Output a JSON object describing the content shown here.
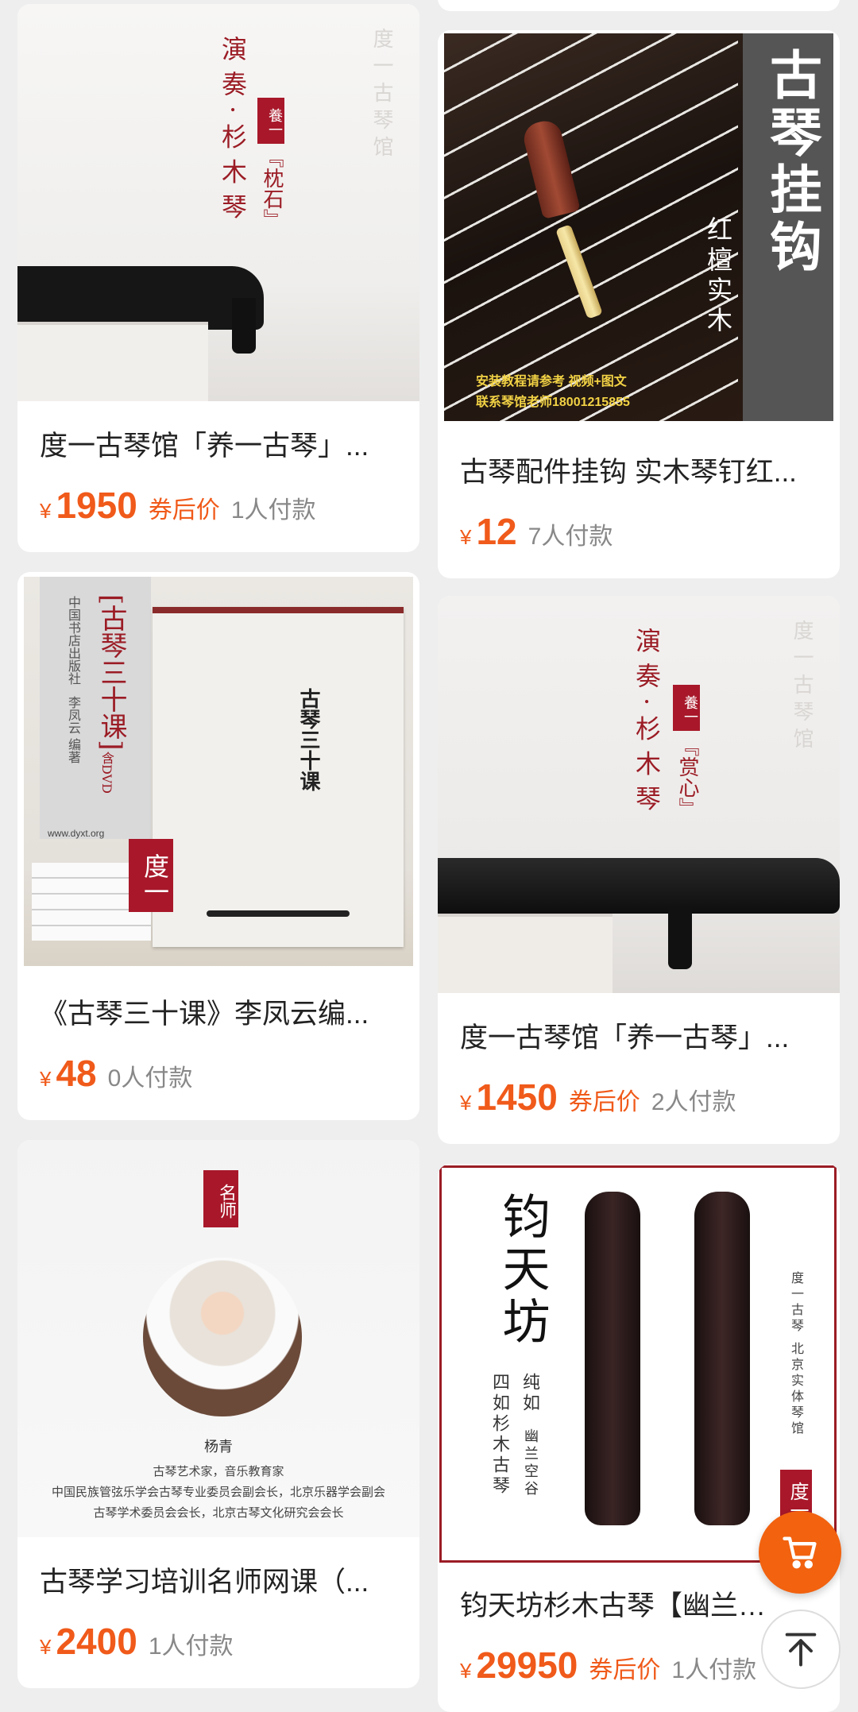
{
  "products": [
    {
      "title": "度一古琴馆「养一古琴」...",
      "price": "1950",
      "coupon": "券后价",
      "sold": "1人付款",
      "art": {
        "vertical_main": "演奏·杉木琴",
        "seal": "養一",
        "sub": "『枕石』",
        "watermark": "度一古琴馆"
      }
    },
    {
      "title": "古琴配件挂钩 实木琴钉红...",
      "price": "12",
      "coupon": "",
      "sold": "7人付款",
      "art": {
        "big": "古琴挂钩",
        "side": "红檀实木",
        "note1": "安装教程请参考 视频+图文",
        "note2": "联系琴馆老师18001215855"
      }
    },
    {
      "title": "《古琴三十课》李凤云编...",
      "price": "48",
      "coupon": "",
      "sold": "0人付款",
      "art": {
        "spine": "[古琴三十课]",
        "spine_dvd": "含DVD",
        "publisher": "中国书店出版社",
        "author": "李凤云 编著",
        "url": "www.dyxt.org",
        "cover_title": "古琴三十课",
        "seal": "度一"
      }
    },
    {
      "title": "度一古琴馆「养一古琴」...",
      "price": "1450",
      "coupon": "券后价",
      "sold": "2人付款",
      "art": {
        "vertical_main": "演奏·杉木琴",
        "seal": "養一",
        "sub": "『赏心』",
        "watermark": "度一古琴馆"
      }
    },
    {
      "title": "古琴学习培训名师网课（...",
      "price": "2400",
      "coupon": "",
      "sold": "1人付款",
      "art": {
        "seal": "名师",
        "name": "杨青",
        "line1": "古琴艺术家，音乐教育家",
        "line2": "中国民族管弦乐学会古琴专业委员会副会长，北京乐器学会副会",
        "line3": "古琴学术委员会会长，北京古琴文化研究会会长"
      }
    },
    {
      "title": "钧天坊杉木古琴【幽兰空...",
      "price": "29950",
      "coupon": "券后价",
      "sold": "1人付款",
      "art": {
        "big": "钧天坊",
        "col1": "四如杉木古琴",
        "col2": "纯如",
        "col3": "幽兰空谷",
        "side": "度一古琴 北京实体琴馆",
        "seal": "度一"
      }
    }
  ],
  "currency_symbol": "¥",
  "floating": {
    "cart_icon": "cart-icon",
    "top_icon": "back-to-top-icon"
  },
  "colors": {
    "accent": "#f05a1a",
    "seal_red": "#a8182a",
    "cart_orange": "#f2620f"
  }
}
